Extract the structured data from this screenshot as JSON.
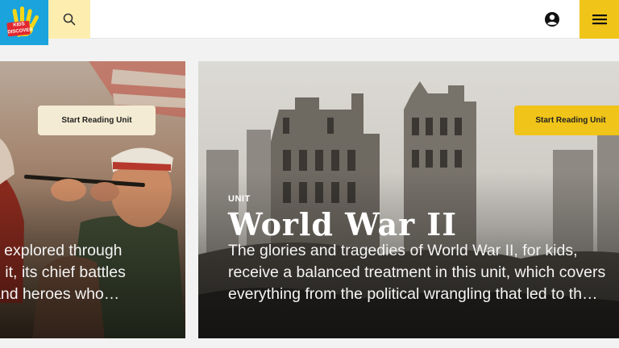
{
  "header": {
    "logo_text": "KIDS DISCOVER",
    "search_icon": "search-icon",
    "account_icon": "user-circle-icon",
    "menu_icon": "hamburger-menu-icon",
    "colors": {
      "logo_bg": "#1aa3dc",
      "search_bg": "#fdeeb0",
      "menu_bg": "#f0c419"
    }
  },
  "carousel": {
    "slides": [
      {
        "cta_label": "Start Reading Unit",
        "description_lines": [
          "s explored through",
          "o it, its chief battles",
          " and heroes who…"
        ]
      },
      {
        "cta_label": "Start Reading Unit",
        "unit_label": "UNIT",
        "title": "World War II",
        "description_lines": [
          "The glories and tragedies of World War II, for kids,",
          "receive a balanced treatment in this unit, which covers",
          "everything from the political wrangling that led to th…"
        ]
      }
    ]
  }
}
